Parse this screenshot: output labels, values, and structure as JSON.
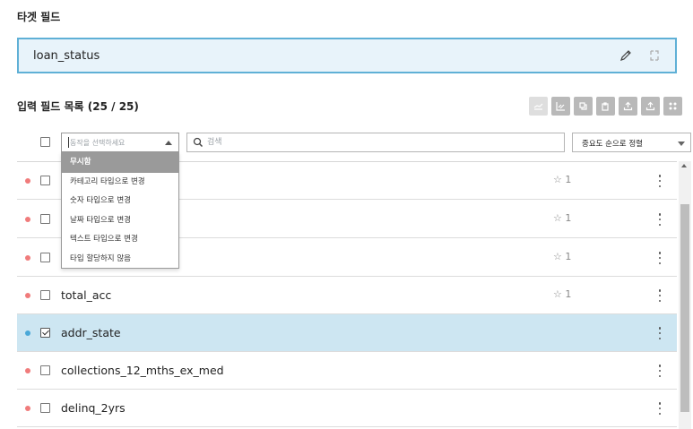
{
  "target": {
    "title": "타겟 필드",
    "value": "loan_status"
  },
  "input_fields": {
    "title": "입력 필드 목록 (25 / 25)"
  },
  "filters": {
    "action_placeholder": "동작을 선택하세요",
    "search_placeholder": "검색",
    "sort_label": "중요도 순으로 정렬"
  },
  "dropdown": {
    "options": [
      "무시함",
      "카테고리 타입으로 변경",
      "숫자 타입으로 변경",
      "날짜 타입으로 변경",
      "텍스트 타입으로 변경",
      "타입 할당하지 않음"
    ]
  },
  "rows": [
    {
      "name": "",
      "star": "☆ 1",
      "checked": false,
      "selected": false,
      "dot": "red"
    },
    {
      "name": "",
      "star": "☆ 1",
      "checked": false,
      "selected": false,
      "dot": "red"
    },
    {
      "name": "",
      "star": "☆ 1",
      "checked": false,
      "selected": false,
      "dot": "red"
    },
    {
      "name": "total_acc",
      "star": "☆ 1",
      "checked": false,
      "selected": false,
      "dot": "red"
    },
    {
      "name": "addr_state",
      "star": "",
      "checked": true,
      "selected": true,
      "dot": "blue"
    },
    {
      "name": "collections_12_mths_ex_med",
      "star": "",
      "checked": false,
      "selected": false,
      "dot": "red"
    },
    {
      "name": "delinq_2yrs",
      "star": "",
      "checked": false,
      "selected": false,
      "dot": "red"
    }
  ],
  "colors": {
    "accent": "#5fb0d6",
    "selected_row": "#cde6f2",
    "dot_red": "#f07b7b",
    "dot_blue": "#4aa8d8"
  }
}
